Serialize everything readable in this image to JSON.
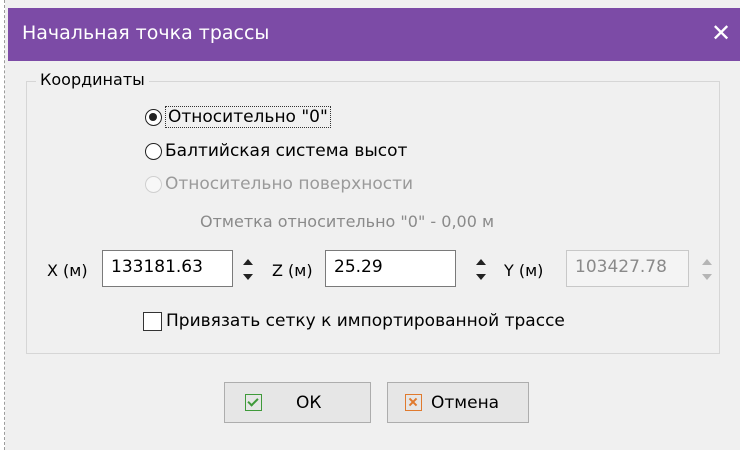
{
  "window": {
    "title": "Начальная точка трассы"
  },
  "coordinates": {
    "group_label": "Координаты",
    "options": [
      {
        "label": "Относительно \"0\"",
        "checked": true,
        "disabled": false
      },
      {
        "label": "Балтийская система высот",
        "checked": false,
        "disabled": false
      },
      {
        "label": "Относительно поверхности",
        "checked": false,
        "disabled": true
      }
    ],
    "elevation_note": "Отметка относительно \"0\" - 0,00 м",
    "x": {
      "label": "X (м)",
      "value": "133181.63"
    },
    "z": {
      "label": "Z (м)",
      "value": "25.29"
    },
    "y": {
      "label": "Y (м)",
      "value": "103427.78",
      "disabled": true
    },
    "snap_grid": {
      "label": "Привязать сетку к импортированной трассе",
      "checked": false
    }
  },
  "buttons": {
    "ok": "ОК",
    "cancel": "Отмена"
  },
  "icons": {
    "close": "close-icon",
    "ok": "check-icon",
    "cancel": "cross-icon"
  },
  "colors": {
    "titlebar": "#7c4ba6",
    "ok_icon": "#3f9a3a",
    "cancel_icon": "#e07a2e"
  }
}
